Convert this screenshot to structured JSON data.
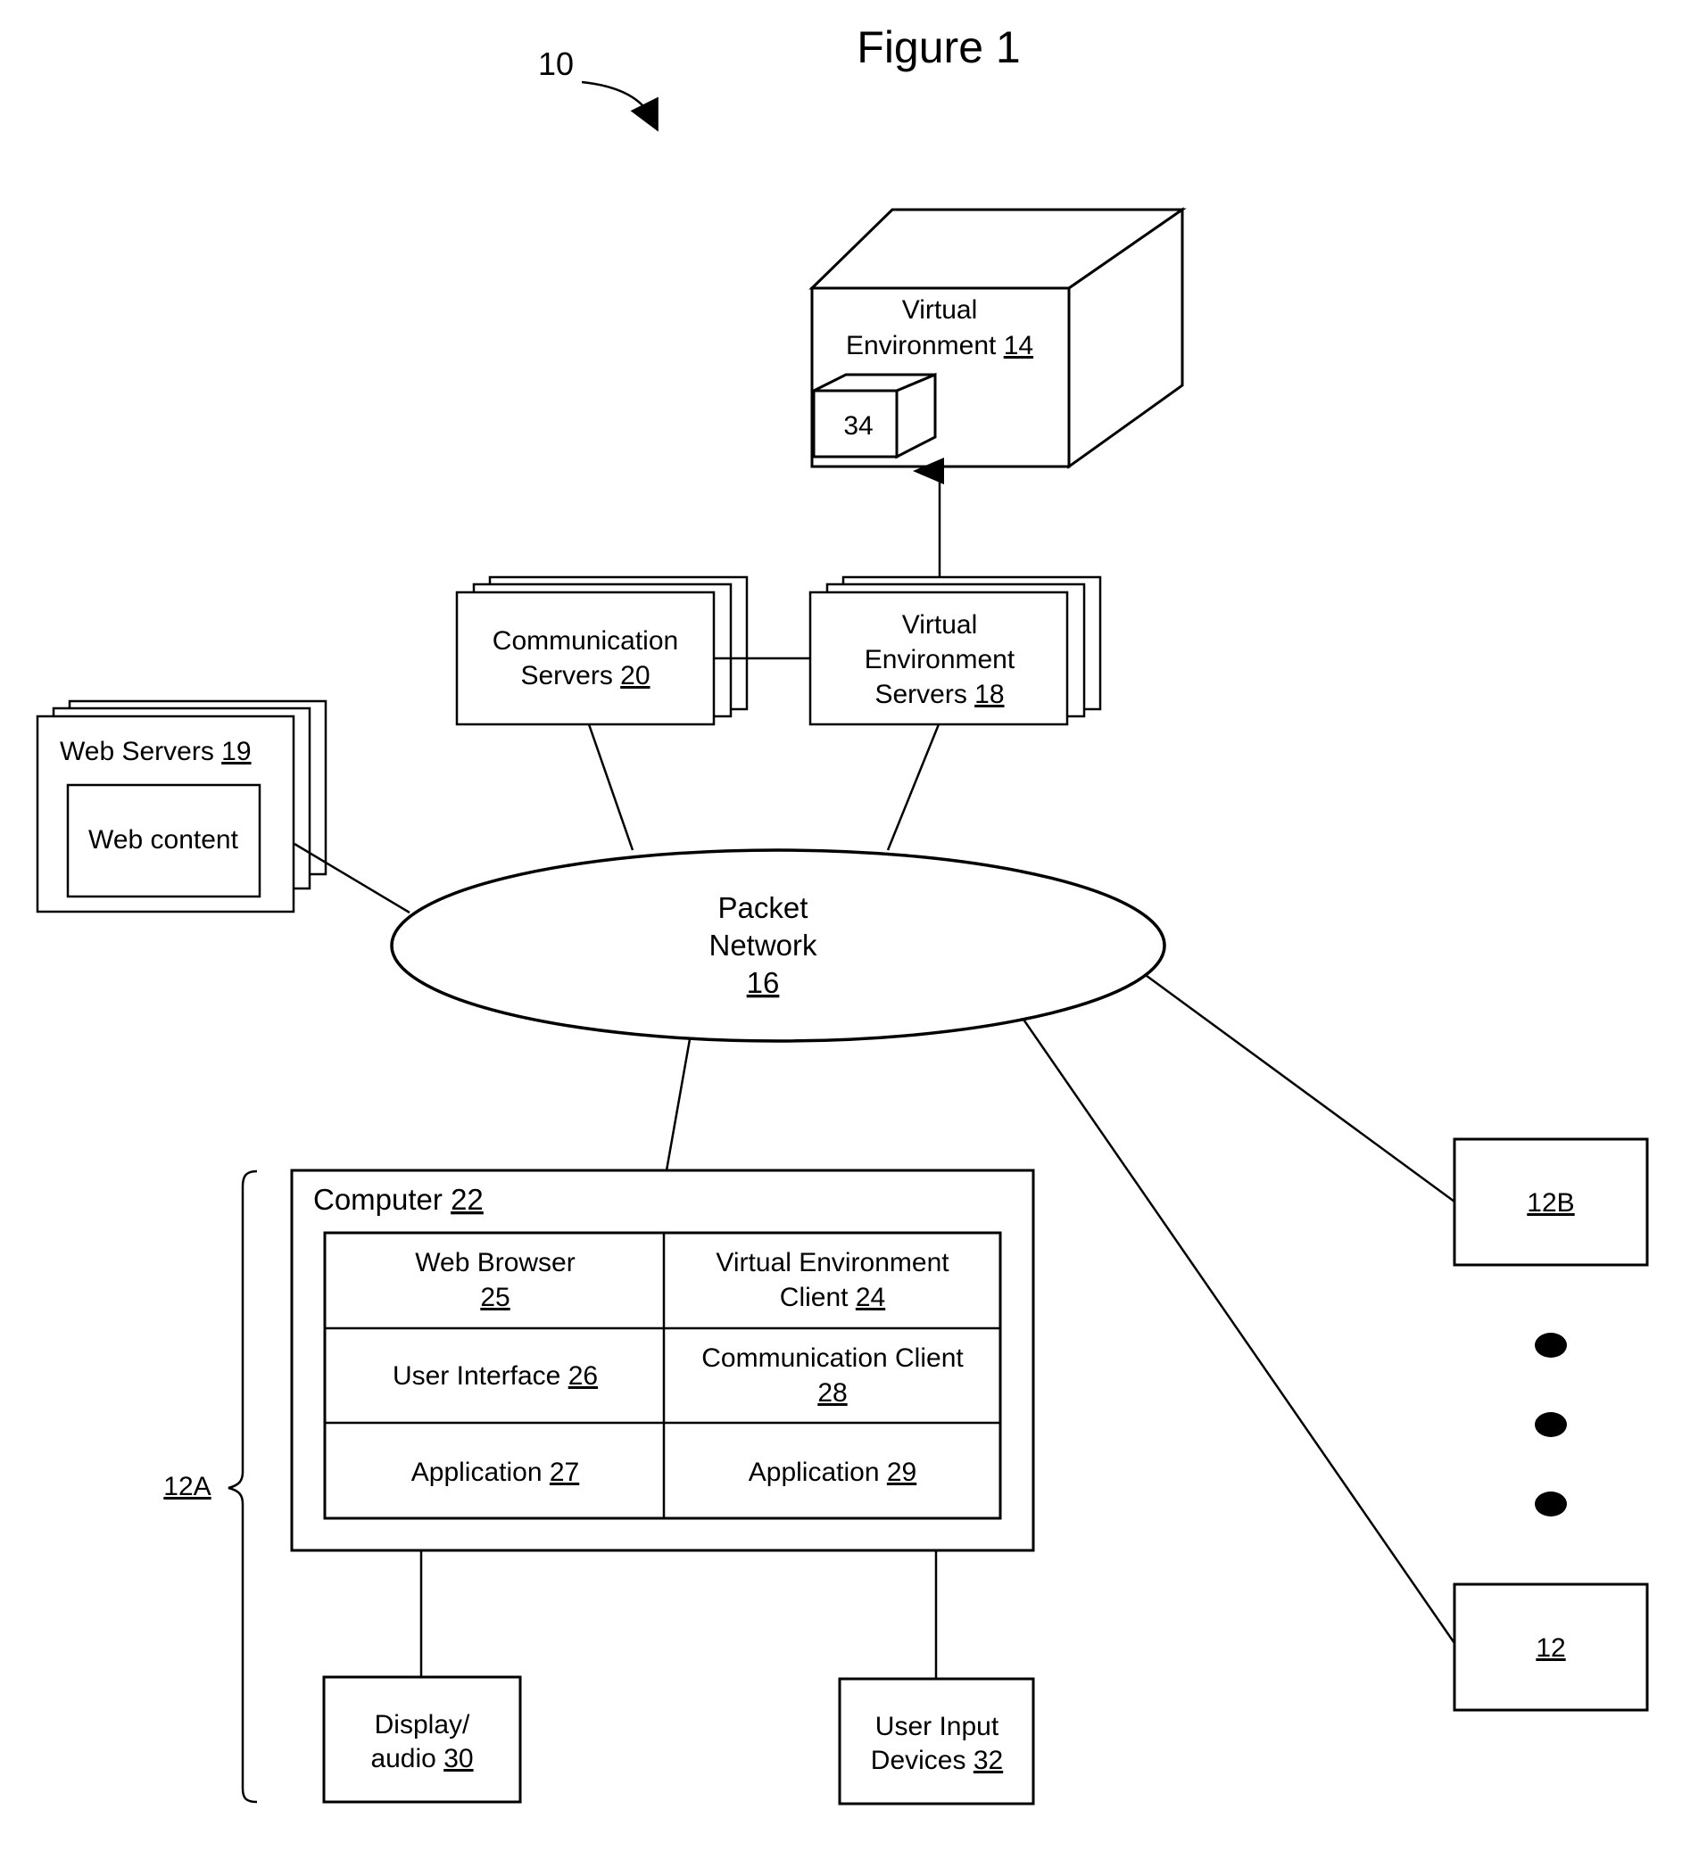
{
  "figure": {
    "title": "Figure 1",
    "system_ref": "10"
  },
  "nodes": {
    "virtual_environment": {
      "line1": "Virtual",
      "line2": "Environment ",
      "ref": "14"
    },
    "object_34": {
      "ref": "34"
    },
    "communication_servers": {
      "line1": "Communication",
      "line2": "Servers ",
      "ref": "20"
    },
    "ve_servers": {
      "line1": "Virtual",
      "line2": "Environment",
      "line3": "Servers ",
      "ref": "18"
    },
    "web_servers": {
      "line1": "Web  Servers ",
      "ref": "19",
      "content": "Web content"
    },
    "packet_network": {
      "line1": "Packet",
      "line2": "Network",
      "ref": "16"
    },
    "computer": {
      "label": "Computer ",
      "ref": "22"
    },
    "modules": [
      {
        "line1": "Web Browser",
        "line2": "",
        "ref": "25"
      },
      {
        "line1": "Virtual Environment",
        "line2": "Client ",
        "ref": "24"
      },
      {
        "line1": "User Interface ",
        "line2": "",
        "ref": "26"
      },
      {
        "line1": "Communication Client",
        "line2": "",
        "ref": "28"
      },
      {
        "line1": "Application ",
        "line2": "",
        "ref": "27"
      },
      {
        "line1": "Application ",
        "line2": "",
        "ref": "29"
      }
    ],
    "display_audio": {
      "line1": "Display/",
      "line2": "audio ",
      "ref": "30"
    },
    "user_input": {
      "line1": "User Input",
      "line2": "Devices ",
      "ref": "32"
    },
    "client_12b": {
      "ref": "12B"
    },
    "client_12": {
      "ref": "12"
    },
    "client_group": {
      "ref": "12A"
    }
  }
}
